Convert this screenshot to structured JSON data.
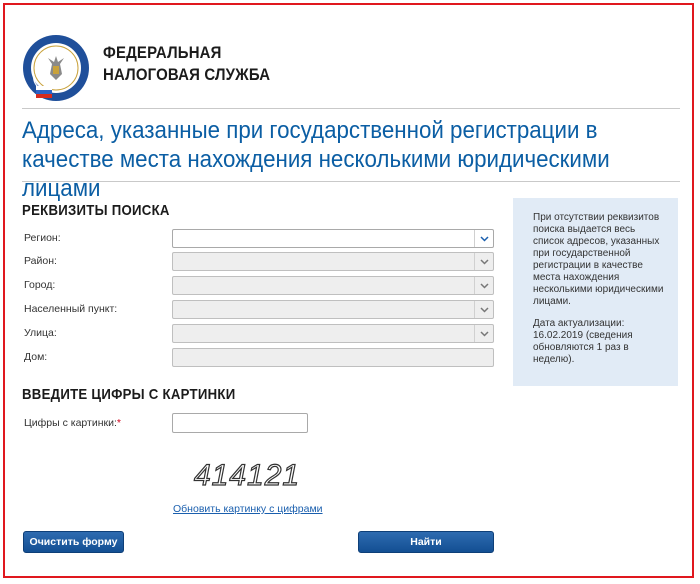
{
  "header": {
    "org_line1": "ФЕДЕРАЛЬНАЯ",
    "org_line2": "НАЛОГОВАЯ СЛУЖБА",
    "logo_icon": "fns-emblem-icon"
  },
  "page_title": "Адреса, указанные при государственной регистрации в качестве места нахождения несколькими юридическими лицами",
  "search": {
    "heading": "РЕКВИЗИТЫ ПОИСКА",
    "fields": [
      {
        "label": "Регион:",
        "value": ""
      },
      {
        "label": "Район:",
        "value": ""
      },
      {
        "label": "Город:",
        "value": ""
      },
      {
        "label": "Населенный пункт:",
        "value": ""
      },
      {
        "label": "Улица:",
        "value": ""
      }
    ],
    "house_label": "Дом:",
    "house_value": ""
  },
  "captcha": {
    "heading": "ВВЕДИТЕ ЦИФРЫ С КАРТИНКИ",
    "label": "Цифры с картинки:",
    "required_mark": "*",
    "image_text": "414121",
    "refresh_link": "Обновить картинку с цифрами"
  },
  "info": {
    "text1": "При отсутствии реквизитов поиска выдается весь список адресов, указанных при государственной регистрации в качестве места нахождения несколькими юридическими лицами.",
    "text2": "Дата актуализации: 16.02.2019 (сведения обновляются 1 раз в неделю)."
  },
  "buttons": {
    "clear": "Очистить форму",
    "find": "Найти"
  },
  "colors": {
    "frame": "#e0181e",
    "title": "#0b5ea4",
    "info_bg": "#e1ebf6",
    "button": "#134f93"
  }
}
